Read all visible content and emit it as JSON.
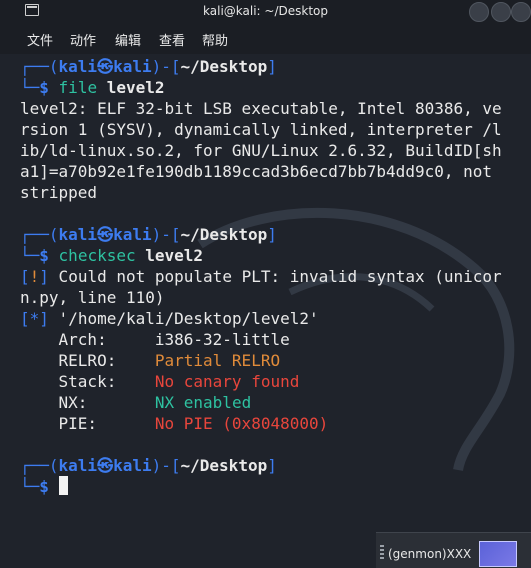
{
  "window": {
    "title": "kali@kali: ~/Desktop"
  },
  "menu": {
    "items": [
      "文件",
      "动作",
      "编辑",
      "查看",
      "帮助"
    ]
  },
  "terminal": {
    "prompt1": {
      "user": "kali",
      "host": "kali",
      "path": "~/Desktop",
      "command": "file",
      "arg": "level2"
    },
    "output1": [
      "level2: ELF 32-bit LSB executable, Intel 80386, ve",
      "rsion 1 (SYSV), dynamically linked, interpreter /l",
      "ib/ld-linux.so.2, for GNU/Linux 2.6.32, BuildID[sh",
      "a1]=a70b92e1fe190db1189ccad3b6ecd7bb7b4dd9c0, not",
      "stripped"
    ],
    "prompt2": {
      "user": "kali",
      "host": "kali",
      "path": "~/Desktop",
      "command": "checksec",
      "arg": "level2"
    },
    "warning": {
      "mark": "!",
      "line1": " Could not populate PLT: invalid syntax (unicor",
      "line2": "n.py, line 110)"
    },
    "info": {
      "mark": "*",
      "text": " '/home/kali/Desktop/level2'"
    },
    "checks": [
      {
        "key": "Arch:",
        "value": "i386-32-little"
      },
      {
        "key": "RELRO:",
        "value": "Partial RELRO"
      },
      {
        "key": "Stack:",
        "value": "No canary found"
      },
      {
        "key": "NX:",
        "value": "NX enabled"
      },
      {
        "key": "PIE:",
        "value": "No PIE (0x8048000)"
      }
    ],
    "prompt3": {
      "user": "kali",
      "host": "kali",
      "path": "~/Desktop"
    }
  },
  "panel": {
    "genmon_label": "(genmon)XXX"
  },
  "colors": {
    "prompt_blue": "#3d7cf0",
    "relro_orange": "#e08b3a",
    "stack_red": "#e8463c",
    "nx_green": "#2ec2a1"
  }
}
